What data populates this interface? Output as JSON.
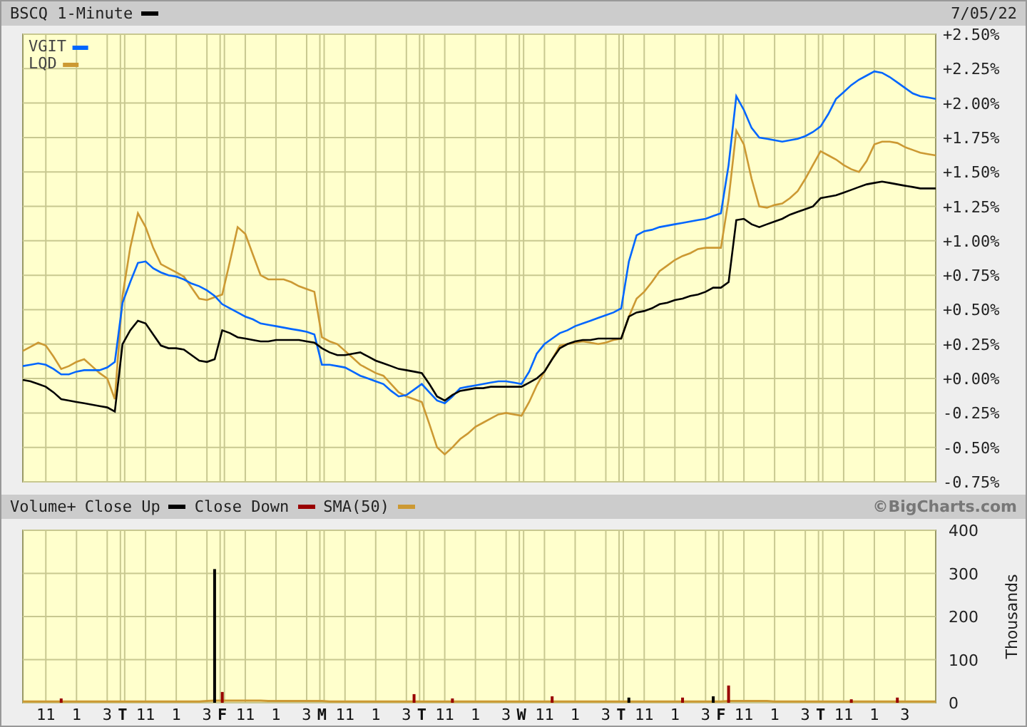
{
  "header": {
    "date": "7/05/22"
  },
  "price_chart": {
    "chart_data": {
      "type": "line",
      "grid": true,
      "legend": true,
      "ylim": [
        -0.75,
        2.5
      ],
      "yticks": [
        {
          "value": 2.5,
          "label": "+2.50%"
        },
        {
          "value": 2.25,
          "label": "+2.25%"
        },
        {
          "value": 2.0,
          "label": "+2.00%"
        },
        {
          "value": 1.75,
          "label": "+1.75%"
        },
        {
          "value": 1.5,
          "label": "+1.50%"
        },
        {
          "value": 1.25,
          "label": "+1.25%"
        },
        {
          "value": 1.0,
          "label": "+1.00%"
        },
        {
          "value": 0.75,
          "label": "+0.75%"
        },
        {
          "value": 0.5,
          "label": "+0.50%"
        },
        {
          "value": 0.25,
          "label": "+0.25%"
        },
        {
          "value": 0,
          "label": "+0.00%"
        },
        {
          "value": -0.25,
          "label": "-0.25%"
        },
        {
          "value": -0.5,
          "label": "-0.50%"
        },
        {
          "value": -0.75,
          "label": "-0.75%"
        }
      ],
      "categories": [
        null,
        null,
        null,
        null,
        null,
        null,
        null,
        null,
        null,
        null,
        null,
        null,
        null,
        null,
        null,
        null,
        null,
        null,
        null,
        null,
        null,
        null,
        null,
        null,
        null,
        null,
        null,
        null,
        null,
        null,
        null,
        null,
        null,
        null,
        null,
        null,
        null,
        null,
        null,
        null,
        null,
        null,
        null,
        null,
        null,
        null,
        null,
        null,
        null,
        null,
        null,
        null,
        null,
        null,
        null,
        null,
        null,
        null,
        null,
        null,
        null,
        null,
        null,
        null,
        null,
        null,
        null,
        null,
        null,
        null,
        null,
        null,
        null,
        null,
        null,
        null,
        null,
        null,
        null,
        null,
        null,
        null,
        null,
        null,
        null,
        null,
        null,
        null,
        null,
        null,
        null,
        null,
        null,
        null,
        null,
        null,
        null,
        null,
        null,
        null,
        null,
        null,
        null,
        null,
        null,
        null,
        null,
        null,
        null,
        null,
        null,
        null,
        null,
        null,
        null,
        null,
        null,
        null,
        null,
        null
      ],
      "series": [
        {
          "name": "BSCQ 1-Minute",
          "color": "#000000",
          "values": [
            -0.01,
            -0.02,
            -0.04,
            -0.06,
            -0.1,
            -0.15,
            -0.16,
            -0.17,
            -0.18,
            -0.19,
            -0.2,
            -0.21,
            -0.24,
            0.25,
            0.35,
            0.42,
            0.4,
            0.32,
            0.24,
            0.22,
            0.22,
            0.21,
            0.17,
            0.13,
            0.12,
            0.14,
            0.35,
            0.33,
            0.3,
            0.29,
            0.28,
            0.27,
            0.27,
            0.28,
            0.28,
            0.28,
            0.28,
            0.27,
            0.26,
            0.22,
            0.19,
            0.17,
            0.17,
            0.18,
            0.19,
            0.16,
            0.13,
            0.11,
            0.09,
            0.07,
            0.06,
            0.05,
            0.04,
            -0.04,
            -0.13,
            -0.16,
            -0.12,
            -0.09,
            -0.08,
            -0.07,
            -0.07,
            -0.06,
            -0.06,
            -0.06,
            -0.06,
            -0.06,
            -0.03,
            0.0,
            0.05,
            0.14,
            0.22,
            0.25,
            0.27,
            0.28,
            0.28,
            0.29,
            0.29,
            0.29,
            0.29,
            0.45,
            0.48,
            0.49,
            0.51,
            0.54,
            0.55,
            0.57,
            0.58,
            0.6,
            0.61,
            0.63,
            0.66,
            0.66,
            0.7,
            1.15,
            1.16,
            1.12,
            1.1,
            1.12,
            1.14,
            1.16,
            1.19,
            1.21,
            1.23,
            1.25,
            1.31,
            1.32,
            1.33,
            1.35,
            1.37,
            1.39,
            1.41,
            1.42,
            1.43,
            1.42,
            1.41,
            1.4,
            1.39,
            1.38,
            1.38,
            1.38
          ]
        },
        {
          "name": "VGIT",
          "color": "#0066ff",
          "values": [
            0.09,
            0.1,
            0.11,
            0.1,
            0.07,
            0.03,
            0.03,
            0.05,
            0.06,
            0.06,
            0.06,
            0.08,
            0.12,
            0.55,
            0.7,
            0.84,
            0.85,
            0.8,
            0.77,
            0.75,
            0.74,
            0.72,
            0.69,
            0.67,
            0.64,
            0.6,
            0.54,
            0.51,
            0.48,
            0.45,
            0.43,
            0.4,
            0.39,
            0.38,
            0.37,
            0.36,
            0.35,
            0.34,
            0.32,
            0.1,
            0.1,
            0.09,
            0.08,
            0.05,
            0.02,
            0.0,
            -0.02,
            -0.04,
            -0.09,
            -0.13,
            -0.12,
            -0.08,
            -0.04,
            -0.1,
            -0.16,
            -0.18,
            -0.13,
            -0.07,
            -0.06,
            -0.05,
            -0.04,
            -0.03,
            -0.02,
            -0.02,
            -0.03,
            -0.04,
            0.05,
            0.18,
            0.25,
            0.29,
            0.33,
            0.35,
            0.38,
            0.4,
            0.42,
            0.44,
            0.46,
            0.48,
            0.51,
            0.85,
            1.04,
            1.07,
            1.08,
            1.1,
            1.11,
            1.12,
            1.13,
            1.14,
            1.15,
            1.16,
            1.18,
            1.2,
            1.55,
            2.05,
            1.95,
            1.82,
            1.75,
            1.74,
            1.73,
            1.72,
            1.73,
            1.74,
            1.76,
            1.79,
            1.83,
            1.92,
            2.03,
            2.08,
            2.13,
            2.17,
            2.2,
            2.23,
            2.22,
            2.19,
            2.15,
            2.11,
            2.07,
            2.05,
            2.04,
            2.03
          ]
        },
        {
          "name": "LQD",
          "color": "#cc9933",
          "values": [
            0.2,
            0.23,
            0.26,
            0.24,
            0.16,
            0.07,
            0.09,
            0.12,
            0.14,
            0.09,
            0.04,
            0.0,
            -0.15,
            0.6,
            0.95,
            1.2,
            1.1,
            0.95,
            0.83,
            0.8,
            0.77,
            0.74,
            0.66,
            0.58,
            0.57,
            0.59,
            0.61,
            0.85,
            1.1,
            1.05,
            0.9,
            0.75,
            0.72,
            0.72,
            0.72,
            0.7,
            0.67,
            0.65,
            0.63,
            0.3,
            0.27,
            0.25,
            0.2,
            0.15,
            0.1,
            0.07,
            0.04,
            0.02,
            -0.04,
            -0.1,
            -0.13,
            -0.15,
            -0.17,
            -0.33,
            -0.5,
            -0.55,
            -0.5,
            -0.44,
            -0.4,
            -0.35,
            -0.32,
            -0.29,
            -0.26,
            -0.25,
            -0.26,
            -0.27,
            -0.17,
            -0.05,
            0.05,
            0.14,
            0.24,
            0.25,
            0.26,
            0.27,
            0.26,
            0.25,
            0.26,
            0.28,
            0.29,
            0.45,
            0.58,
            0.63,
            0.7,
            0.78,
            0.82,
            0.86,
            0.89,
            0.91,
            0.94,
            0.95,
            0.95,
            0.95,
            1.3,
            1.8,
            1.7,
            1.45,
            1.25,
            1.24,
            1.26,
            1.27,
            1.31,
            1.36,
            1.45,
            1.55,
            1.65,
            1.62,
            1.59,
            1.55,
            1.52,
            1.5,
            1.58,
            1.7,
            1.72,
            1.72,
            1.71,
            1.68,
            1.66,
            1.64,
            1.63,
            1.62
          ]
        }
      ]
    }
  },
  "volume_chart": {
    "credit": "©BigCharts.com",
    "chart_data": {
      "type": "bar",
      "grid": true,
      "title": "Volume+",
      "ylabel": "Thousands",
      "ylim": [
        0,
        400
      ],
      "yticks": [
        400,
        300,
        200,
        100,
        0
      ],
      "categories": [
        null,
        null,
        null,
        "11",
        null,
        null,
        null,
        "1",
        null,
        null,
        null,
        "3",
        null,
        "T",
        null,
        null,
        "11",
        null,
        null,
        null,
        "1",
        null,
        null,
        null,
        "3",
        null,
        "F",
        null,
        null,
        "11",
        null,
        null,
        null,
        "1",
        null,
        null,
        null,
        "3",
        null,
        "M",
        null,
        null,
        "11",
        null,
        null,
        null,
        "1",
        null,
        null,
        null,
        "3",
        null,
        "T",
        null,
        null,
        "11",
        null,
        null,
        null,
        "1",
        null,
        null,
        null,
        "3",
        null,
        "W",
        null,
        null,
        "11",
        null,
        null,
        null,
        "1",
        null,
        null,
        null,
        "3",
        null,
        "T",
        null,
        null,
        "11",
        null,
        null,
        null,
        "1",
        null,
        null,
        null,
        "3",
        null,
        "F",
        null,
        null,
        "11",
        null,
        null,
        null,
        "1",
        null,
        null,
        null,
        "3",
        null,
        "T",
        null,
        null,
        "11",
        null,
        null,
        null,
        "1",
        null,
        null,
        null,
        "3",
        null,
        null,
        null,
        null
      ],
      "series": [
        {
          "name": "Close Up",
          "color": "#000000",
          "values": [
            null,
            null,
            null,
            null,
            null,
            null,
            null,
            null,
            null,
            null,
            null,
            null,
            null,
            null,
            null,
            null,
            null,
            null,
            null,
            null,
            null,
            null,
            null,
            null,
            null,
            310,
            null,
            null,
            null,
            null,
            null,
            null,
            null,
            null,
            null,
            null,
            null,
            null,
            null,
            null,
            null,
            null,
            null,
            null,
            null,
            null,
            null,
            null,
            null,
            null,
            null,
            null,
            null,
            null,
            null,
            null,
            null,
            null,
            null,
            null,
            null,
            null,
            null,
            null,
            null,
            null,
            null,
            null,
            null,
            null,
            null,
            null,
            null,
            null,
            null,
            null,
            null,
            null,
            null,
            12,
            null,
            null,
            null,
            null,
            null,
            null,
            null,
            null,
            null,
            null,
            15,
            null,
            null,
            null,
            null,
            null,
            null,
            null,
            null,
            null,
            null,
            null,
            null,
            null,
            null,
            null,
            null,
            null,
            null,
            null,
            null,
            null,
            null,
            null,
            null,
            null,
            null,
            null,
            null,
            null
          ]
        },
        {
          "name": "Close Down",
          "color": "#990000",
          "values": [
            null,
            null,
            null,
            null,
            null,
            10,
            null,
            null,
            null,
            null,
            null,
            null,
            null,
            null,
            null,
            null,
            null,
            null,
            null,
            null,
            null,
            null,
            null,
            null,
            null,
            null,
            25,
            null,
            null,
            null,
            null,
            null,
            null,
            null,
            null,
            null,
            null,
            null,
            null,
            null,
            null,
            null,
            null,
            null,
            null,
            null,
            null,
            null,
            null,
            null,
            null,
            20,
            null,
            null,
            null,
            null,
            10,
            null,
            null,
            null,
            null,
            null,
            null,
            null,
            null,
            null,
            null,
            null,
            null,
            15,
            null,
            null,
            null,
            null,
            null,
            null,
            null,
            null,
            null,
            null,
            null,
            null,
            null,
            null,
            null,
            null,
            12,
            null,
            null,
            null,
            null,
            null,
            40,
            null,
            null,
            null,
            null,
            null,
            null,
            null,
            null,
            null,
            null,
            null,
            null,
            null,
            null,
            null,
            8,
            null,
            null,
            null,
            null,
            null,
            12,
            null,
            null,
            null,
            null,
            null
          ]
        },
        {
          "name": "SMA(50)",
          "color": "#cc9933",
          "type": "line",
          "values": [
            3,
            3,
            3,
            3,
            3,
            3,
            3,
            3,
            3,
            3,
            3,
            3,
            3,
            3,
            3,
            3,
            3,
            3,
            3,
            3,
            3,
            3,
            3,
            3,
            4,
            5,
            5,
            5,
            5,
            5,
            5,
            5,
            4,
            4,
            4,
            4,
            4,
            4,
            4,
            4,
            3,
            3,
            3,
            3,
            3,
            3,
            3,
            3,
            3,
            3,
            3,
            3,
            3,
            3,
            3,
            3,
            3,
            3,
            3,
            3,
            3,
            3,
            3,
            3,
            3,
            3,
            3,
            3,
            3,
            3,
            3,
            3,
            3,
            3,
            3,
            3,
            3,
            3,
            3,
            3,
            3,
            3,
            3,
            3,
            3,
            3,
            3,
            3,
            3,
            3,
            3,
            3,
            4,
            4,
            4,
            4,
            4,
            4,
            3,
            3,
            3,
            3,
            3,
            3,
            3,
            3,
            3,
            3,
            3,
            3,
            3,
            3,
            3,
            3,
            3,
            3,
            3,
            3,
            3,
            3
          ]
        }
      ]
    }
  }
}
